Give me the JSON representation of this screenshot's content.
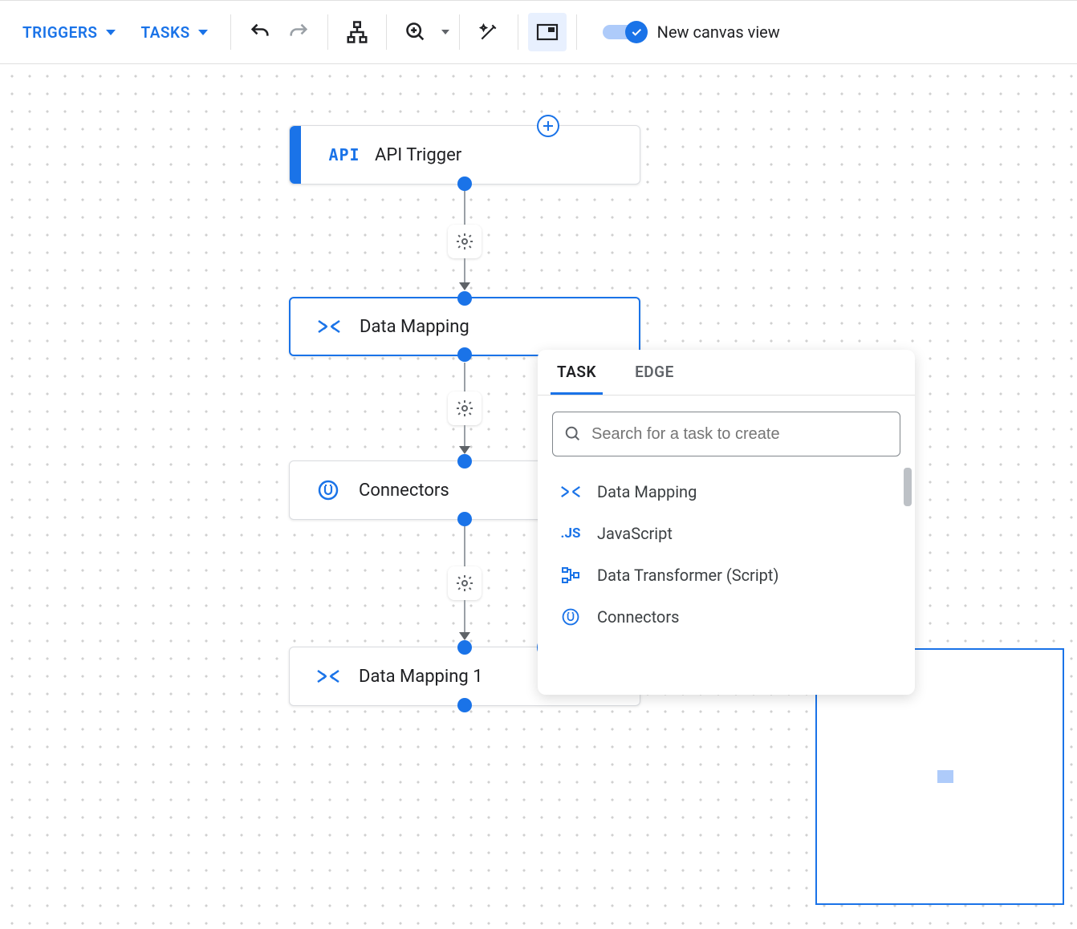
{
  "toolbar": {
    "triggers_label": "TRIGGERS",
    "tasks_label": "TASKS",
    "toggle_label": "New canvas view",
    "toggle_on": true
  },
  "nodes": {
    "api_trigger": {
      "label": "API Trigger",
      "icon_text": "API"
    },
    "data_mapping": {
      "label": "Data Mapping"
    },
    "connectors": {
      "label": "Connectors"
    },
    "data_mapping_1": {
      "label": "Data Mapping 1"
    }
  },
  "panel": {
    "tabs": {
      "task": "TASK",
      "edge": "EDGE"
    },
    "search_placeholder": "Search for a task to create",
    "items": [
      {
        "label": "Data Mapping",
        "icon": "mapping"
      },
      {
        "label": "JavaScript",
        "icon": "js"
      },
      {
        "label": "Data Transformer (Script)",
        "icon": "transformer"
      },
      {
        "label": "Connectors",
        "icon": "connector"
      }
    ]
  },
  "icons": {
    "js_text": ".JS"
  }
}
